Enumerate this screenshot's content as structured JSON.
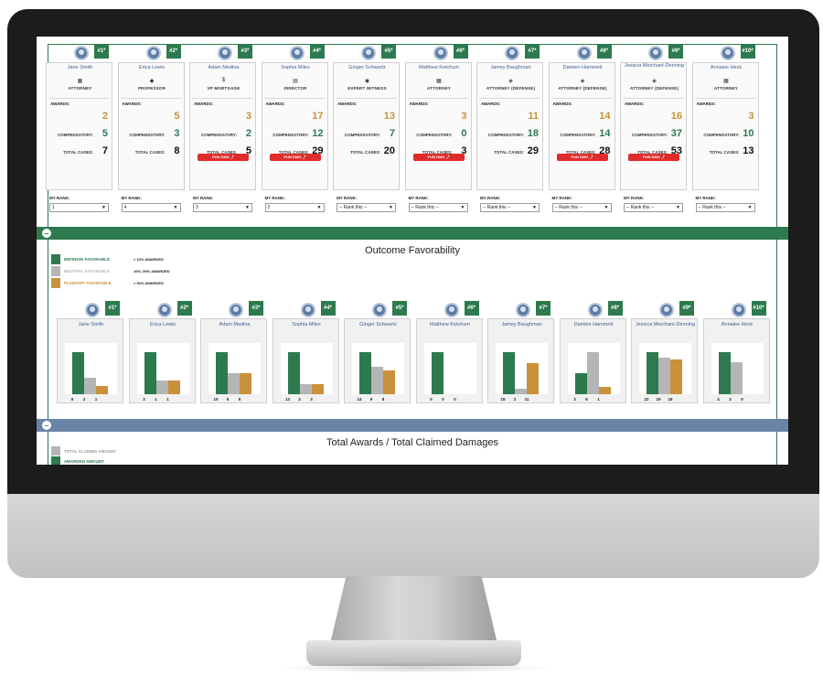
{
  "colors": {
    "green": "#2d7a4f",
    "gray": "#b5b5b5",
    "gold": "#c9913a",
    "red": "#e02b2b",
    "blue_bar": "#6b83a7",
    "name_blue": "#3d5f8f"
  },
  "labels": {
    "awards": "AWARDS:",
    "compensatory": "COMPENSATORY:",
    "total_cases": "TOTAL CASES:",
    "my_rank": "MY RANK:",
    "pun_dmg": "PUN DMG"
  },
  "jurors": [
    {
      "rank": "#1*",
      "name": "Jane Smith",
      "icon": "courthouse-icon",
      "icon_glyph": "▦",
      "role": "ATTORNEY",
      "awards": "2",
      "compensatory": "5",
      "total_cases": "7",
      "pun_dmg": false,
      "my_rank": "1"
    },
    {
      "rank": "#2*",
      "name": "Erica Lewis",
      "icon": "graduation-cap-icon",
      "icon_glyph": "◆",
      "role": "PROFESSOR",
      "awards": "5",
      "compensatory": "3",
      "total_cases": "8",
      "pun_dmg": false,
      "my_rank": "4"
    },
    {
      "rank": "#3*",
      "name": "Adam Medina",
      "icon": "dollar-icon",
      "icon_glyph": "$",
      "role": "VP MORTGAGE",
      "awards": "3",
      "compensatory": "2",
      "total_cases": "5",
      "pun_dmg": true,
      "my_rank": "3"
    },
    {
      "rank": "#4*",
      "name": "Sophia Miles",
      "icon": "document-icon",
      "icon_glyph": "▤",
      "role": "DIRECTOR",
      "awards": "17",
      "compensatory": "12",
      "total_cases": "29",
      "pun_dmg": true,
      "my_rank": "2"
    },
    {
      "rank": "#5*",
      "name": "Ginger Schwartz",
      "icon": "mouse-icon",
      "icon_glyph": "◉",
      "role": "EXPERT WITNESS",
      "awards": "13",
      "compensatory": "7",
      "total_cases": "20",
      "pun_dmg": false,
      "my_rank": "-- Rank this --"
    },
    {
      "rank": "#6*",
      "name": "Matthew Ketchum",
      "icon": "courthouse-icon",
      "icon_glyph": "▦",
      "role": "ATTORNEY",
      "awards": "3",
      "compensatory": "0",
      "total_cases": "3",
      "pun_dmg": true,
      "my_rank": "-- Rank this --"
    },
    {
      "rank": "#7*",
      "name": "Jamey Baughman",
      "icon": "shield-icon",
      "icon_glyph": "◈",
      "role": "ATTORNEY (DEFENSE)",
      "awards": "11",
      "compensatory": "18",
      "total_cases": "29",
      "pun_dmg": false,
      "my_rank": "-- Rank this --"
    },
    {
      "rank": "#8*",
      "name": "Damien Hammett",
      "icon": "shield-icon",
      "icon_glyph": "◈",
      "role": "ATTORNEY (DEFENSE)",
      "awards": "14",
      "compensatory": "14",
      "total_cases": "28",
      "pun_dmg": true,
      "my_rank": "-- Rank this --"
    },
    {
      "rank": "#9*",
      "name": "Jessica Merchant-Denning",
      "icon": "shield-icon",
      "icon_glyph": "◈",
      "role": "ATTORNEY (DEFENSE)",
      "awards": "16",
      "compensatory": "37",
      "total_cases": "53",
      "pun_dmg": true,
      "my_rank": "-- Rank this --"
    },
    {
      "rank": "#10*",
      "name": "Annalee Heck",
      "icon": "courthouse-icon",
      "icon_glyph": "▦",
      "role": "ATTORNEY",
      "awards": "3",
      "compensatory": "10",
      "total_cases": "13",
      "pun_dmg": false,
      "my_rank": "-- Rank this --"
    }
  ],
  "favorability": {
    "title": "Outcome Favorability",
    "legend": [
      {
        "key": "DEFENSE FAVORABLE",
        "desc": "< 10% AWARDED",
        "color": "#2d7a4f"
      },
      {
        "key": "NEUTRAL FAVORABLE",
        "desc": "10%–50% AWARDED",
        "color": "#b5b5b5"
      },
      {
        "key": "PLAINTIFF FAVORABLE",
        "desc": "> 50% AWARDED",
        "color": "#c9913a"
      }
    ]
  },
  "chart_data": {
    "type": "bar",
    "series": [
      {
        "name": "DEFENSE FAVORABLE",
        "color": "#2d7a4f"
      },
      {
        "name": "NEUTRAL FAVORABLE",
        "color": "#b5b5b5"
      },
      {
        "name": "PLAINTIFF FAVORABLE",
        "color": "#c9913a"
      }
    ],
    "panels": [
      {
        "juror": "Jane Smith",
        "rank": "#1*",
        "values": [
          5,
          2,
          1
        ]
      },
      {
        "juror": "Erica Lewis",
        "rank": "#2*",
        "values": [
          3,
          1,
          1
        ]
      },
      {
        "juror": "Adam Medina",
        "rank": "#3*",
        "values": [
          10,
          5,
          5
        ]
      },
      {
        "juror": "Sophia Miles",
        "rank": "#4*",
        "values": [
          13,
          3,
          3
        ]
      },
      {
        "juror": "Ginger Schwartz",
        "rank": "#5*",
        "values": [
          14,
          9,
          8
        ]
      },
      {
        "juror": "Matthew Ketchum",
        "rank": "#6*",
        "values": [
          5,
          0,
          0
        ]
      },
      {
        "juror": "Jamey Baughman",
        "rank": "#7*",
        "values": [
          15,
          2,
          11
        ]
      },
      {
        "juror": "Damien Hammett",
        "rank": "#8*",
        "values": [
          3,
          6,
          1
        ]
      },
      {
        "juror": "Jessica Merchant-Denning",
        "rank": "#9*",
        "values": [
          22,
          19,
          18
        ]
      },
      {
        "juror": "Annalee Heck",
        "rank": "#10*",
        "values": [
          4,
          3,
          0
        ]
      }
    ]
  },
  "totals_section": {
    "title": "Total Awards / Total Claimed Damages",
    "legend": [
      {
        "key": "TOTAL CLAIMED AMOUNT",
        "color": "#b5b5b5"
      },
      {
        "key": "AWARDED AMOUNT",
        "color": "#2d7a4f"
      }
    ]
  }
}
